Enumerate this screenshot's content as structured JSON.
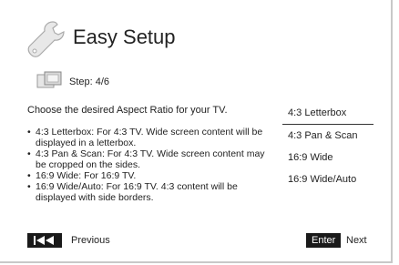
{
  "header": {
    "title": "Easy Setup",
    "icon": "wrench-icon"
  },
  "step": {
    "label": "Step: 4/6",
    "icon": "screen-aspect-icon"
  },
  "question": "Choose the desired Aspect Ratio for your TV.",
  "descriptions": [
    "4:3 Letterbox: For 4:3 TV.  Wide screen content will be displayed in a letterbox.",
    "4:3 Pan & Scan: For 4:3 TV.  Wide screen content may be cropped on the sides.",
    "16:9 Wide: For 16:9 TV.",
    "16:9 Wide/Auto: For 16:9 TV.  4:3 content will be displayed with side borders."
  ],
  "options": [
    {
      "label": "4:3 Letterbox",
      "selected": true
    },
    {
      "label": "4:3 Pan & Scan",
      "selected": false
    },
    {
      "label": "16:9 Wide",
      "selected": false
    },
    {
      "label": "16:9 Wide/Auto",
      "selected": false
    }
  ],
  "footer": {
    "previous_label": "Previous",
    "enter_label": "Enter",
    "next_label": "Next"
  }
}
